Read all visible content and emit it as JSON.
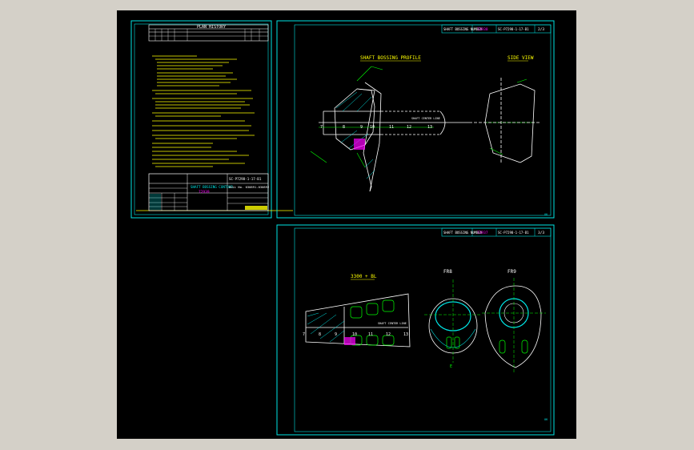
{
  "colors": {
    "background": "#000000",
    "frame": "#00e5e5",
    "geometry": "#ffffff",
    "dimension": "#00ff00",
    "note": "#ffff00",
    "highlight": "#ff00ff",
    "hatch": "#00e5e5",
    "window_bg": "#d4d0c8"
  },
  "sheet1": {
    "title_block": {
      "header": "PLAN HISTORY",
      "dwg_label": "SC-P7298-1-17-B1",
      "title_main": "SHAFT BOSSING CONTOUR",
      "title_id": "72939",
      "hull_label": "HULL No. 030891-030892"
    }
  },
  "sheet2": {
    "header_left": "SHAFT BOSSING NUMBER",
    "header_id": "72938",
    "header_dwg": "SC-P7298-1-17-B1",
    "header_page": "2/3",
    "view1_title": "SHAFT BOSSING PROFILE",
    "view2_title": "SIDE VIEW",
    "stations": [
      "7",
      "8",
      "9",
      "10",
      "11",
      "12",
      "13"
    ],
    "center_note": "SHAFT CENTER LINE"
  },
  "sheet3": {
    "header_left": "SHAFT BOSSING NUMBER",
    "header_id": "72937",
    "header_dwg": "SC-P7298-1-17-B1",
    "header_page": "3/3",
    "view1_title": "3300 + BL",
    "view2_title": "FR8",
    "view3_title": "FR9",
    "stations": [
      "7",
      "8",
      "9",
      "10",
      "11",
      "12",
      "13"
    ],
    "center_note": "SHAFT CENTER LINE",
    "center_label": "E"
  }
}
